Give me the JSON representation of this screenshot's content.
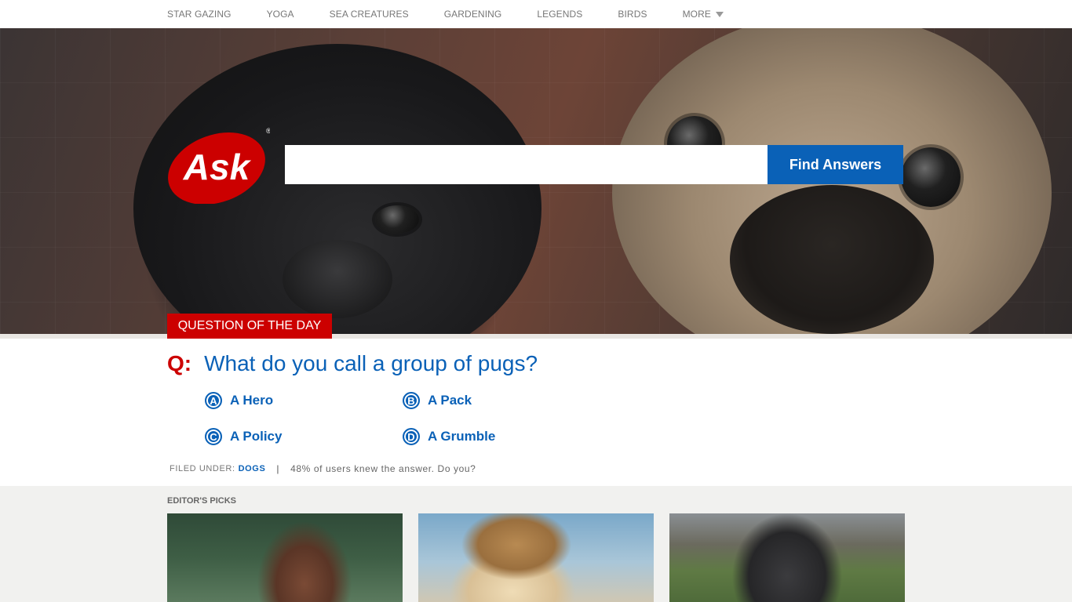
{
  "nav": {
    "items": [
      "STAR GAZING",
      "YOGA",
      "SEA CREATURES",
      "GARDENING",
      "LEGENDS",
      "BIRDS"
    ],
    "more_label": "MORE"
  },
  "hero": {
    "logo_text": "Ask",
    "search": {
      "value": "",
      "placeholder": "",
      "button_label": "Find Answers"
    },
    "qotd_label": "QUESTION OF THE DAY"
  },
  "question": {
    "prefix": "Q:",
    "text": "What do you call a group of pugs?",
    "answers": [
      {
        "letter": "A",
        "text": "A Hero"
      },
      {
        "letter": "B",
        "text": "A Pack"
      },
      {
        "letter": "C",
        "text": "A Policy"
      },
      {
        "letter": "D",
        "text": "A Grumble"
      }
    ],
    "filed_label": "FILED UNDER:",
    "category": "DOGS",
    "separator": "|",
    "stat": "48% of users knew the answer. Do you?"
  },
  "picks": {
    "heading": "EDITOR'S PICKS"
  },
  "colors": {
    "brand_red": "#cc0000",
    "brand_blue": "#0a61b7"
  }
}
